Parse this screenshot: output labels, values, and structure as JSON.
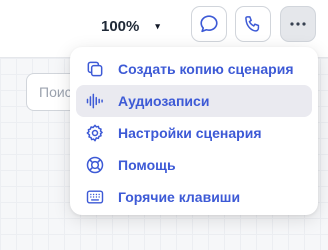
{
  "toolbar": {
    "zoom_value": "100%",
    "zoom_caret": "▾",
    "chat_icon": "chat-bubble-icon",
    "call_icon": "phone-icon",
    "more_icon": "more-horizontal-icon"
  },
  "search": {
    "placeholder": "Поис"
  },
  "menu": {
    "items": [
      {
        "label": "Создать копию сценария",
        "icon": "copy-icon"
      },
      {
        "label": "Аудиозаписи",
        "icon": "audio-wave-icon"
      },
      {
        "label": "Настройки сценария",
        "icon": "gear-icon"
      },
      {
        "label": "Помощь",
        "icon": "lifebuoy-icon"
      },
      {
        "label": "Горячие клавиши",
        "icon": "keyboard-icon"
      }
    ]
  },
  "colors": {
    "accent": "#3d5ad6",
    "hover": "#eaeaf0"
  }
}
